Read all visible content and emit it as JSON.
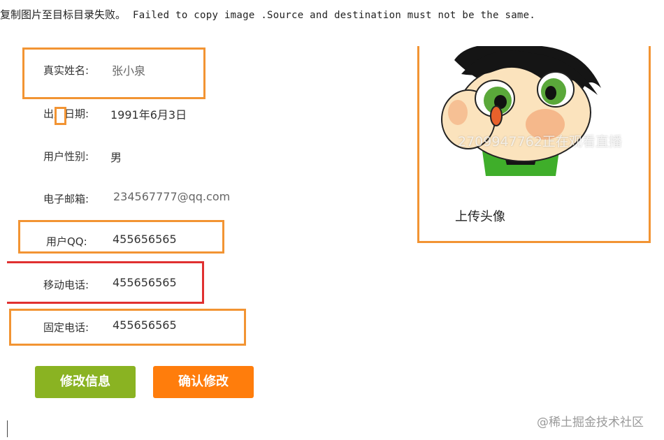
{
  "error": {
    "cn": "复制图片至目标目录失败。",
    "en": "Failed to copy image .Source and destination must not be the same."
  },
  "form": {
    "name_label": "真实姓名:",
    "name_value": "张小泉",
    "birth_label": "出生日期:",
    "birth_value": "1991年6月3日",
    "gender_label": "用户性别:",
    "gender_value": "男",
    "email_label": "电子邮箱:",
    "email_value": "234567777@qq.com",
    "qq_label": "用户QQ:",
    "qq_value": "455656565",
    "mobile_label": "移动电话:",
    "mobile_value": "455656565",
    "phone_label": "固定电话:",
    "phone_value": "455656565"
  },
  "buttons": {
    "edit": "修改信息",
    "confirm": "确认修改"
  },
  "avatar": {
    "upload_label": "上传头像",
    "overlay_text": "2709947762正在观看直播"
  },
  "watermark": "@稀土掘金技术社区",
  "colors": {
    "highlight_orange": "#f29433",
    "highlight_red": "#e03030",
    "edit_button": "#8ab322",
    "confirm_button": "#ff7d0c"
  }
}
